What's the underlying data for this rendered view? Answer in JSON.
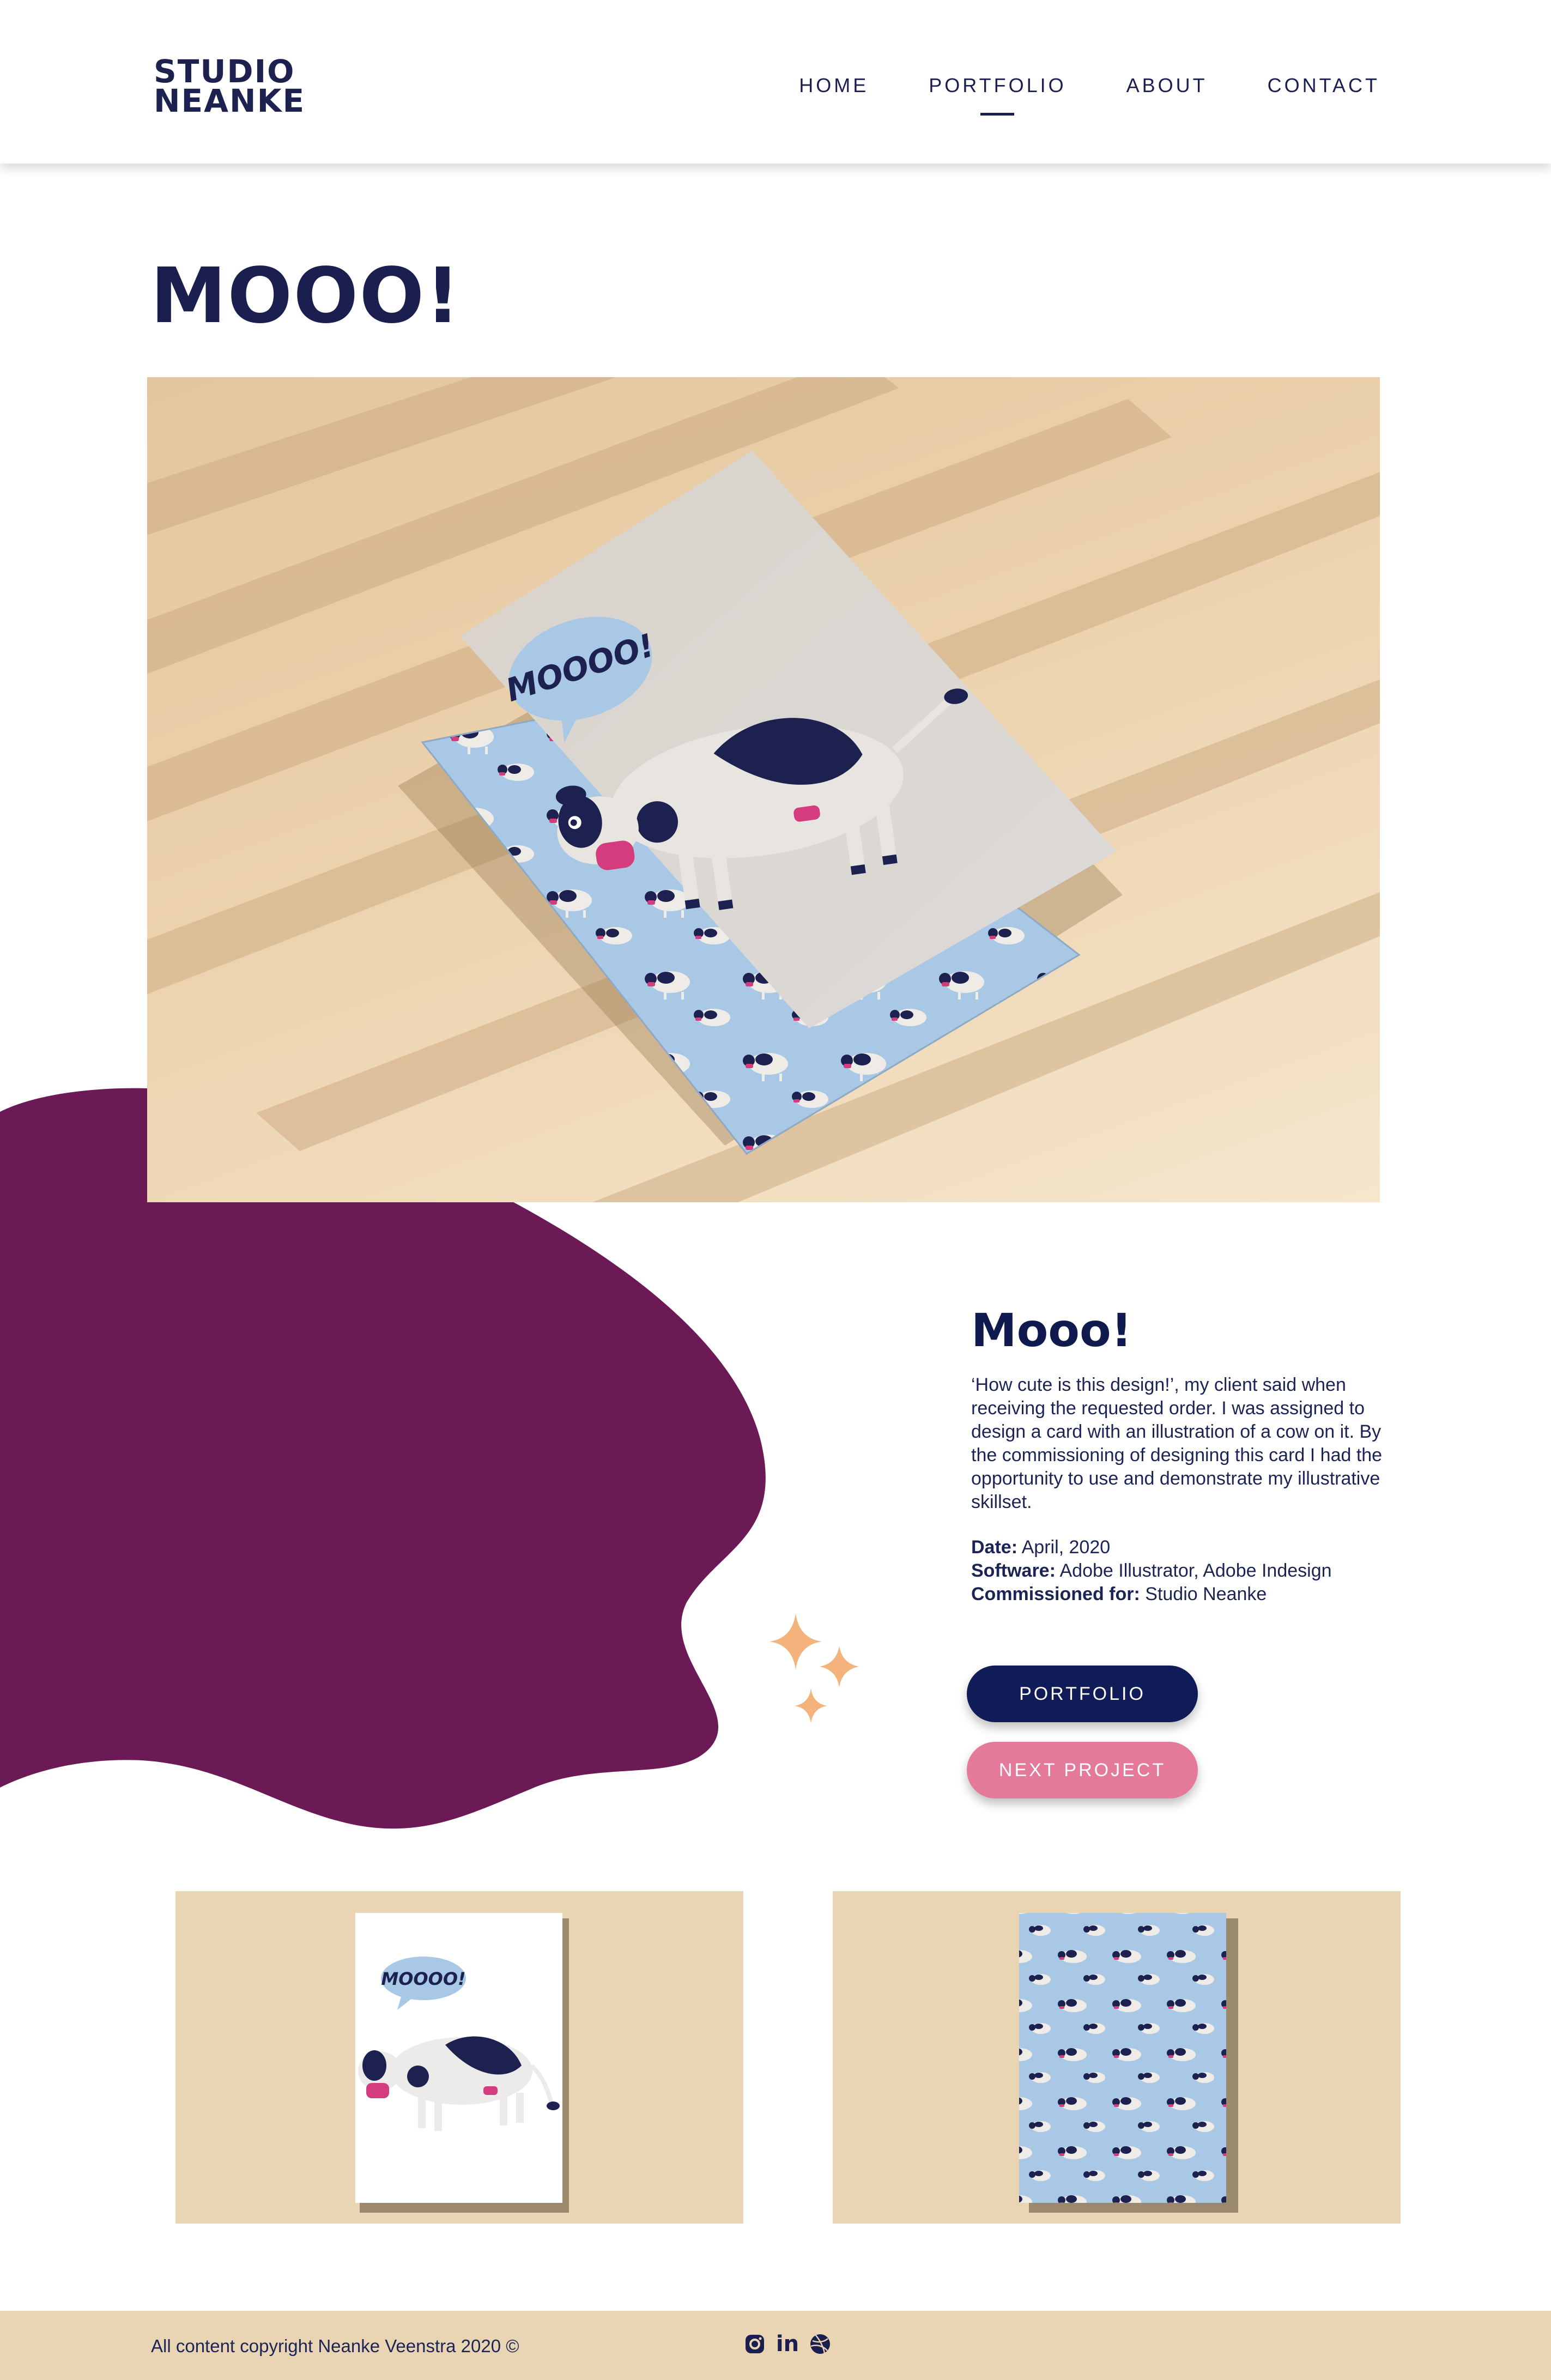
{
  "header": {
    "logo_line1": "STUDIO",
    "logo_line2": "NEANKE",
    "nav": [
      {
        "label": "HOME"
      },
      {
        "label": "PORTFOLIO",
        "active": true
      },
      {
        "label": "ABOUT"
      },
      {
        "label": "CONTACT"
      }
    ]
  },
  "page": {
    "title": "MOOO!"
  },
  "hero": {
    "speech_text": "MOOOO!"
  },
  "project": {
    "heading": "Mooo!",
    "description": "‘How cute is this design!’, my client said when receiving the requested order. I was assigned to design a card with an illustration of a cow on it. By the commissioning of designing this card I had the opportunity to use and demonstrate my illustrative skillset.",
    "date_label": "Date:",
    "date_value": "April, 2020",
    "software_label": "Software:",
    "software_value": "Adobe Illustrator, Adobe Indesign",
    "commissioned_label": "Commissioned for:",
    "commissioned_value": "Studio Neanke"
  },
  "buttons": {
    "portfolio": "PORTFOLIO",
    "next_project": "NEXT PROJECT"
  },
  "gallery": {
    "card_speech_text": "MOOOO!"
  },
  "footer": {
    "copyright": "All content copyright Neanke Veenstra 2020 ©",
    "socials": [
      {
        "icon": "instagram-icon"
      },
      {
        "icon": "linkedin-icon",
        "text": "in"
      },
      {
        "icon": "dribbble-icon"
      }
    ]
  },
  "colors": {
    "navy": "#1b1f4f",
    "plum": "#6c1a56",
    "pink": "#e5799a",
    "sand": "#e9d5b4",
    "peach": "#f4b27c",
    "sky": "#a9c8e6"
  }
}
